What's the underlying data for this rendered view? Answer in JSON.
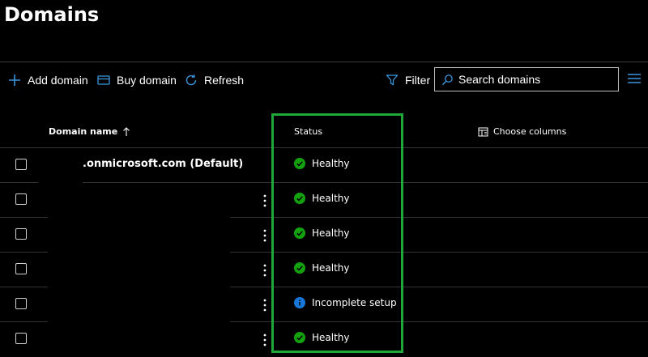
{
  "page": {
    "title": "Domains"
  },
  "toolbar": {
    "add_label": "Add domain",
    "buy_label": "Buy domain",
    "refresh_label": "Refresh",
    "filter_label": "Filter",
    "search_placeholder": "Search domains"
  },
  "table": {
    "columns": {
      "domain": "Domain name",
      "status": "Status",
      "choose": "Choose columns"
    },
    "rows": [
      {
        "domain": ".onmicrosoft.com (Default)",
        "status": "Healthy",
        "status_type": "healthy"
      },
      {
        "domain": "",
        "status": "Healthy",
        "status_type": "healthy"
      },
      {
        "domain": "",
        "status": "Healthy",
        "status_type": "healthy"
      },
      {
        "domain": "",
        "status": "Healthy",
        "status_type": "healthy"
      },
      {
        "domain": "",
        "status": "Incomplete setup",
        "status_type": "info"
      },
      {
        "domain": "",
        "status": "Healthy",
        "status_type": "healthy"
      }
    ]
  },
  "colors": {
    "accent": "#3a96dd",
    "healthy": "#13a10e",
    "info": "#1677d8",
    "highlight": "#1fa83a"
  },
  "icons": {
    "add": "plus-icon",
    "buy": "card-icon",
    "refresh": "refresh-icon",
    "filter": "filter-icon",
    "search": "search-icon",
    "menu": "list-icon",
    "sort": "sort-arrow-icon",
    "choose": "columns-icon"
  }
}
